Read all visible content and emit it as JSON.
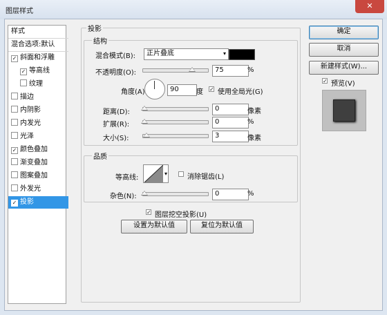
{
  "window": {
    "title": "图层样式",
    "close_glyph": "✕"
  },
  "sidebar": {
    "items": [
      {
        "label": "样式",
        "checkbox": false,
        "checked": false,
        "indent": false,
        "selected": false,
        "head": true
      },
      {
        "label": "混合选项:默认",
        "checkbox": false,
        "checked": false,
        "indent": false,
        "selected": false,
        "head": true
      },
      {
        "label": "斜面和浮雕",
        "checkbox": true,
        "checked": true,
        "indent": false,
        "selected": false
      },
      {
        "label": "等高线",
        "checkbox": true,
        "checked": true,
        "indent": true,
        "selected": false
      },
      {
        "label": "纹理",
        "checkbox": true,
        "checked": false,
        "indent": true,
        "selected": false
      },
      {
        "label": "描边",
        "checkbox": true,
        "checked": false,
        "indent": false,
        "selected": false
      },
      {
        "label": "内阴影",
        "checkbox": true,
        "checked": false,
        "indent": false,
        "selected": false
      },
      {
        "label": "内发光",
        "checkbox": true,
        "checked": false,
        "indent": false,
        "selected": false
      },
      {
        "label": "光泽",
        "checkbox": true,
        "checked": false,
        "indent": false,
        "selected": false
      },
      {
        "label": "颜色叠加",
        "checkbox": true,
        "checked": true,
        "indent": false,
        "selected": false
      },
      {
        "label": "渐变叠加",
        "checkbox": true,
        "checked": false,
        "indent": false,
        "selected": false
      },
      {
        "label": "图案叠加",
        "checkbox": true,
        "checked": false,
        "indent": false,
        "selected": false
      },
      {
        "label": "外发光",
        "checkbox": true,
        "checked": false,
        "indent": false,
        "selected": false
      },
      {
        "label": "投影",
        "checkbox": true,
        "checked": true,
        "indent": false,
        "selected": true
      }
    ]
  },
  "shadow": {
    "group_title": "投影",
    "structure": {
      "title": "结构",
      "blend_mode_label": "混合模式(B):",
      "blend_mode_value": "正片叠底",
      "blend_color": "#000000",
      "opacity_label": "不透明度(O):",
      "opacity_value": "75",
      "opacity_unit": "%",
      "angle_label": "角度(A):",
      "angle_value": "90",
      "angle_unit": "度",
      "global_light_label": "使用全局光(G)",
      "global_light_checked": true,
      "distance_label": "距离(D):",
      "distance_value": "0",
      "distance_unit": "像素",
      "spread_label": "扩展(R):",
      "spread_value": "0",
      "spread_unit": "%",
      "size_label": "大小(S):",
      "size_value": "3",
      "size_unit": "像素"
    },
    "quality": {
      "title": "品质",
      "contour_label": "等高线:",
      "antialias_label": "消除锯齿(L)",
      "antialias_checked": false,
      "noise_label": "杂色(N):",
      "noise_value": "0",
      "noise_unit": "%"
    },
    "knockout_label": "图层挖空投影(U)",
    "knockout_checked": true,
    "make_default_label": "设置为默认值",
    "reset_default_label": "复位为默认值"
  },
  "buttons": {
    "ok": "确定",
    "cancel": "取消",
    "new_style": "新建样式(W)...",
    "preview_label": "预览(V)",
    "preview_checked": true
  },
  "colors": {
    "accent": "#3296e6",
    "preview_swatch": "#3f3f3f"
  },
  "icons": {
    "check": "✓",
    "dropdown": "▾"
  }
}
